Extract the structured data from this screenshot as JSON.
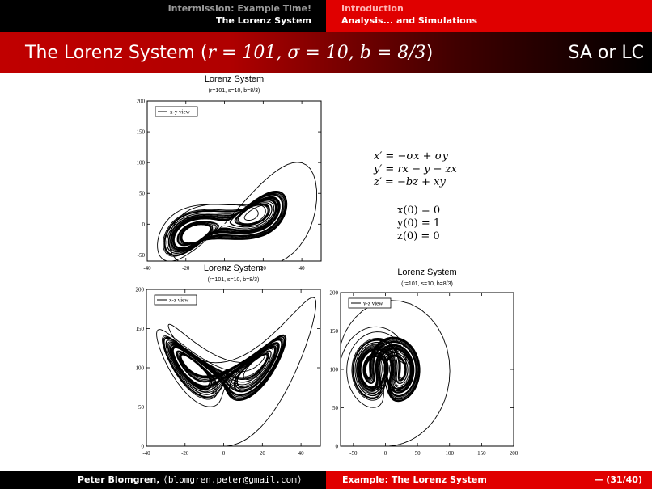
{
  "header": {
    "left_section": "Intermission: Example Time!",
    "left_subsection": "The Lorenz System",
    "right_section": "Introduction",
    "right_subsection": "Analysis... and Simulations"
  },
  "slide": {
    "title_main": "The Lorenz System (",
    "title_math": "r = 101, σ = 10, b = 8/3",
    "title_close": ")",
    "title_right": "SA or LC"
  },
  "equations": {
    "lines": [
      "x′ = −σx + σy",
      "y′ = rx − y − zx",
      "z′ = −bz + xy"
    ],
    "initial": [
      "x(0) = 0",
      "y(0) = 1",
      "z(0) = 0"
    ]
  },
  "footer": {
    "author": "Peter Blomgren,",
    "email": "⟨blomgren.peter@gmail.com⟩",
    "title": "Example: The Lorenz System",
    "page": "— (31/40)"
  },
  "chart_data": [
    {
      "type": "line",
      "title": "Lorenz System",
      "subtitle": "(r=101, s=10, b=8/3)",
      "legend": "x-y view",
      "legend_position": "top-left",
      "xlim": [
        -40,
        50
      ],
      "ylim": [
        -60,
        200
      ],
      "xticks": [
        "-40",
        "-20",
        "0",
        "20",
        "40"
      ],
      "yticks": [
        "-50",
        "0",
        "50",
        "100",
        "150",
        "200"
      ]
    },
    {
      "type": "line",
      "title": "Lorenz System",
      "subtitle": "(r=101, s=10, b=8/3)",
      "legend": "x-z view",
      "legend_position": "top-left",
      "xlim": [
        -40,
        50
      ],
      "ylim": [
        0,
        200
      ],
      "xticks": [
        "-40",
        "-20",
        "0",
        "20",
        "40"
      ],
      "yticks": [
        "0",
        "50",
        "100",
        "150",
        "200"
      ]
    },
    {
      "type": "line",
      "title": "Lorenz System",
      "subtitle": "(r=101, s=10, b=8/3)",
      "legend": "y-z view",
      "legend_position": "top-left",
      "xlim": [
        -70,
        200
      ],
      "ylim": [
        0,
        200
      ],
      "xticks": [
        "-50",
        "0",
        "50",
        "100",
        "150",
        "200"
      ],
      "yticks": [
        "0",
        "50",
        "100",
        "150",
        "200"
      ]
    }
  ]
}
